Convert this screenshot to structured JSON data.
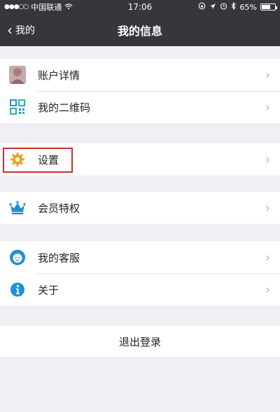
{
  "status_bar": {
    "signal": "●●●○○",
    "carrier": "中国联通",
    "wifi": "wifi-icon",
    "time": "17:06",
    "battery_percent": "65%",
    "battery_level": 0.65
  },
  "nav": {
    "back_label": "我的",
    "title": "我的信息"
  },
  "sections": [
    {
      "items": [
        {
          "label": "账户详情",
          "icon": "avatar-icon"
        },
        {
          "label": "我的二维码",
          "icon": "qr-code-icon"
        }
      ]
    },
    {
      "items": [
        {
          "label": "设置",
          "icon": "gear-icon",
          "highlighted": true
        }
      ]
    },
    {
      "items": [
        {
          "label": "会员特权",
          "icon": "crown-icon"
        }
      ]
    },
    {
      "items": [
        {
          "label": "我的客服",
          "icon": "customer-service-icon"
        },
        {
          "label": "关于",
          "icon": "info-icon"
        }
      ]
    }
  ],
  "logout_label": "退出登录",
  "colors": {
    "nav_bg": "#36373b",
    "page_bg": "#efeff4",
    "highlight": "#c9302c",
    "gear": "#f0a020",
    "blue": "#1e90d8"
  }
}
